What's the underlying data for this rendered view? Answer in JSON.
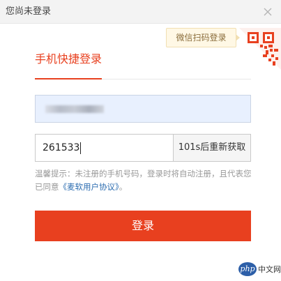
{
  "window": {
    "title": "您尚未登录"
  },
  "qr_login": {
    "tip": "微信扫码登录"
  },
  "tab": {
    "label": "手机快捷登录"
  },
  "phone_field": {
    "value": ""
  },
  "code_field": {
    "value": "261533"
  },
  "resend": {
    "label": "101s后重新获取"
  },
  "notice": {
    "text": "温馨提示：未注册的手机号码，登录时将自动注册，且代表您已同意",
    "link": "《麦软用户协议》",
    "suffix": "。"
  },
  "login_button": {
    "label": "登录"
  },
  "watermark": {
    "badge": "php",
    "text": "中文网"
  },
  "colors": {
    "accent": "#e8401f",
    "link": "#2b6cb0",
    "field_autofill": "#e8f0fe"
  }
}
